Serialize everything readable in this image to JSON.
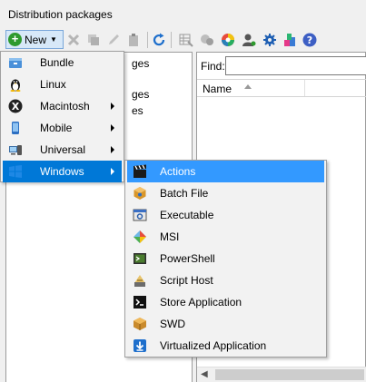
{
  "window": {
    "title": "Distribution packages"
  },
  "toolbar": {
    "new_label": "New",
    "icons": [
      "delete-icon",
      "copy-icon",
      "edit-icon",
      "clipboard-icon",
      "refresh-icon",
      "grid-icon",
      "group-icon",
      "color-icon",
      "user-icon",
      "gear-icon",
      "tools-icon",
      "help-icon"
    ]
  },
  "left_panel": {
    "fragments": [
      "ges",
      "ges",
      "es"
    ]
  },
  "right_panel": {
    "find_label": "Find:",
    "find_value": "",
    "column_name": "Name"
  },
  "new_menu": {
    "items": [
      {
        "label": "Bundle",
        "icon": "bundle-icon",
        "has_submenu": false
      },
      {
        "label": "Linux",
        "icon": "linux-icon",
        "has_submenu": false
      },
      {
        "label": "Macintosh",
        "icon": "macintosh-icon",
        "has_submenu": true
      },
      {
        "label": "Mobile",
        "icon": "mobile-icon",
        "has_submenu": true
      },
      {
        "label": "Universal",
        "icon": "universal-icon",
        "has_submenu": true
      },
      {
        "label": "Windows",
        "icon": "windows-icon",
        "has_submenu": true,
        "highlighted": true
      }
    ]
  },
  "windows_submenu": {
    "items": [
      {
        "label": "Actions",
        "icon": "clapperboard-icon",
        "highlighted": true
      },
      {
        "label": "Batch File",
        "icon": "batch-file-icon"
      },
      {
        "label": "Executable",
        "icon": "executable-icon"
      },
      {
        "label": "MSI",
        "icon": "msi-icon"
      },
      {
        "label": "PowerShell",
        "icon": "powershell-icon"
      },
      {
        "label": "Script Host",
        "icon": "script-host-icon"
      },
      {
        "label": "Store Application",
        "icon": "store-application-icon"
      },
      {
        "label": "SWD",
        "icon": "swd-icon"
      },
      {
        "label": "Virtualized Application",
        "icon": "virtualized-application-icon"
      }
    ]
  },
  "colors": {
    "menu_highlight": "#0078d7",
    "submenu_highlight": "#3399ff"
  }
}
